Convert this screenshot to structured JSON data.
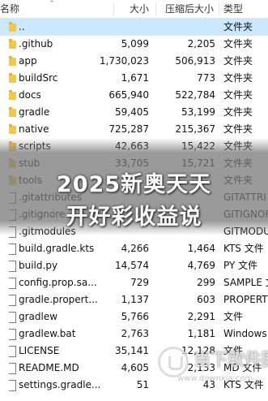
{
  "columns": {
    "name": "名称",
    "size": "大小",
    "compressed": "压缩后大小",
    "type": "类型"
  },
  "rows": [
    {
      "name": "..",
      "size": "",
      "compressed": "",
      "type": "文件夹",
      "icon": "folder",
      "selected": true
    },
    {
      "name": ".github",
      "size": "5,099",
      "compressed": "2,205",
      "type": "文件夹",
      "icon": "folder"
    },
    {
      "name": "app",
      "size": "1,730,023",
      "compressed": "506,913",
      "type": "文件夹",
      "icon": "folder"
    },
    {
      "name": "buildSrc",
      "size": "1,671",
      "compressed": "773",
      "type": "文件夹",
      "icon": "folder"
    },
    {
      "name": "docs",
      "size": "665,940",
      "compressed": "522,784",
      "type": "文件夹",
      "icon": "folder"
    },
    {
      "name": "gradle",
      "size": "59,405",
      "compressed": "53,199",
      "type": "文件夹",
      "icon": "folder"
    },
    {
      "name": "native",
      "size": "725,287",
      "compressed": "215,367",
      "type": "文件夹",
      "icon": "folder"
    },
    {
      "name": "scripts",
      "size": "42,663",
      "compressed": "15,422",
      "type": "文件夹",
      "icon": "folder"
    },
    {
      "name": "stub",
      "size": "33,705",
      "compressed": "15,721",
      "type": "文件夹",
      "icon": "folder"
    },
    {
      "name": "tools",
      "size": "",
      "compressed": "",
      "type": "文件夹",
      "icon": "folder"
    },
    {
      "name": ".gitattributes",
      "size": "",
      "compressed": "",
      "type": "GITATTRI",
      "icon": "file"
    },
    {
      "name": ".gitignore",
      "size": "",
      "compressed": "",
      "type": "GITIGNOR",
      "icon": "file"
    },
    {
      "name": ".gitmodules",
      "size": "",
      "compressed": "",
      "type": "GITMODU",
      "icon": "file"
    },
    {
      "name": "build.gradle.kts",
      "size": "4,266",
      "compressed": "1,464",
      "type": "KTS 文件",
      "icon": "file"
    },
    {
      "name": "build.py",
      "size": "14,574",
      "compressed": "4,769",
      "type": "PY 文件",
      "icon": "file"
    },
    {
      "name": "config.prop.sa...",
      "size": "729",
      "compressed": "299",
      "type": "SAMPLE 文",
      "icon": "file"
    },
    {
      "name": "gradle.propert...",
      "size": "1,137",
      "compressed": "603",
      "type": "PROPERT",
      "icon": "file"
    },
    {
      "name": "gradlew",
      "size": "5,766",
      "compressed": "2,291",
      "type": "文件",
      "icon": "file"
    },
    {
      "name": "gradlew.bat",
      "size": "2,763",
      "compressed": "1,181",
      "type": "Windows",
      "icon": "file"
    },
    {
      "name": "LICENSE",
      "size": "35,141",
      "compressed": "12,128",
      "type": "文件",
      "icon": "file"
    },
    {
      "name": "README.MD",
      "size": "4,605",
      "compressed": "2,133",
      "type": "MD 文件",
      "icon": "file"
    },
    {
      "name": "settings.gradle...",
      "size": "51",
      "compressed": "43",
      "type": "KTS 文件",
      "icon": "file"
    }
  ],
  "overlay": {
    "line1": "2025新奥天天",
    "line2": "开好彩收益说"
  },
  "watermark": {
    "brand": "当下软件园",
    "url": "www.downxia.com"
  },
  "colors": {
    "selected_row": "#cce8ff",
    "folder": "#f3c844"
  }
}
